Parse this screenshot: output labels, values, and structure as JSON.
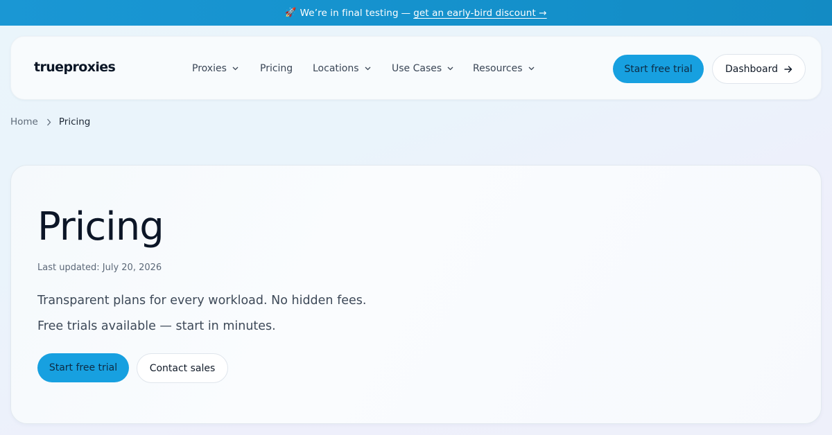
{
  "banner": {
    "icon": "rocket-icon",
    "text": "We’re in final testing",
    "separator": "—",
    "link": "get an early-bird discount →"
  },
  "header": {
    "logo": "trueproxies",
    "nav": [
      {
        "label": "Proxies",
        "dropdown": true
      },
      {
        "label": "Pricing",
        "dropdown": false
      },
      {
        "label": "Locations",
        "dropdown": true
      },
      {
        "label": "Use Cases",
        "dropdown": true
      },
      {
        "label": "Resources",
        "dropdown": true
      }
    ],
    "cta_primary": "Start free trial",
    "cta_secondary": "Dashboard"
  },
  "breadcrumb": {
    "home": "Home",
    "current": "Pricing"
  },
  "hero": {
    "title": "Pricing",
    "updated": "Last updated: July 20, 2026",
    "lede_1": "Transparent plans for every workload. No hidden fees.",
    "lede_2": "Free trials available — start in minutes.",
    "cta_primary": "Start free trial",
    "cta_secondary": "Contact sales"
  },
  "colors": {
    "accent": "#17a0e0",
    "banner_bg": "#1592cd",
    "text_dark": "#0c1627"
  }
}
